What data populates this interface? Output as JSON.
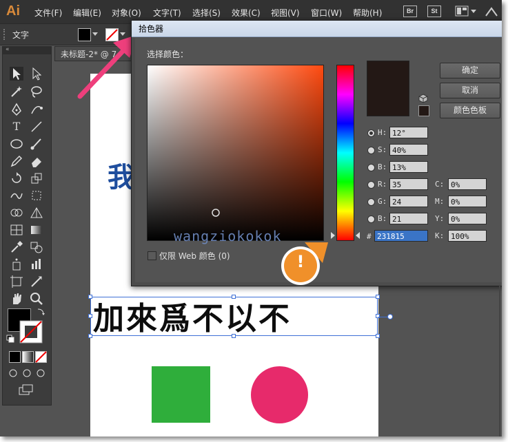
{
  "app": {
    "logo": "Ai"
  },
  "menu": [
    "文件(F)",
    "编辑(E)",
    "对象(O)",
    "文字(T)",
    "选择(S)",
    "效果(C)",
    "视图(V)",
    "窗口(W)",
    "帮助(H)"
  ],
  "menu_badges": [
    "Br",
    "St"
  ],
  "control_bar": {
    "label": "文字"
  },
  "document_tab": {
    "title": "未标题-2* @ 7"
  },
  "canvas": {
    "partial_char": "我",
    "headline": "加來爲不以不",
    "shapes": {
      "square_color": "#2fae3b",
      "circle_color": "#e72a6b"
    }
  },
  "dialog": {
    "title": "拾色器",
    "section_label": "选择颜色：",
    "watermark": "wangziokokok",
    "web_only_label": "仅限 Web 颜色 (0)",
    "buttons": {
      "ok": "确定",
      "cancel": "取消",
      "swatches": "颜色色板"
    },
    "current_color": "#231815",
    "hsb": [
      {
        "label": "H:",
        "value": "12°",
        "selected": true
      },
      {
        "label": "S:",
        "value": "40%",
        "selected": false
      },
      {
        "label": "B:",
        "value": "13%",
        "selected": false
      }
    ],
    "rgb": [
      {
        "label": "R:",
        "value": "35"
      },
      {
        "label": "G:",
        "value": "24"
      },
      {
        "label": "B:",
        "value": "21"
      }
    ],
    "cmyk": [
      {
        "label": "C:",
        "value": "0%"
      },
      {
        "label": "M:",
        "value": "0%"
      },
      {
        "label": "Y:",
        "value": "0%"
      },
      {
        "label": "K:",
        "value": "100%"
      }
    ],
    "hex_label": "#",
    "hex_value": "231815",
    "alert_glyph": "!"
  }
}
